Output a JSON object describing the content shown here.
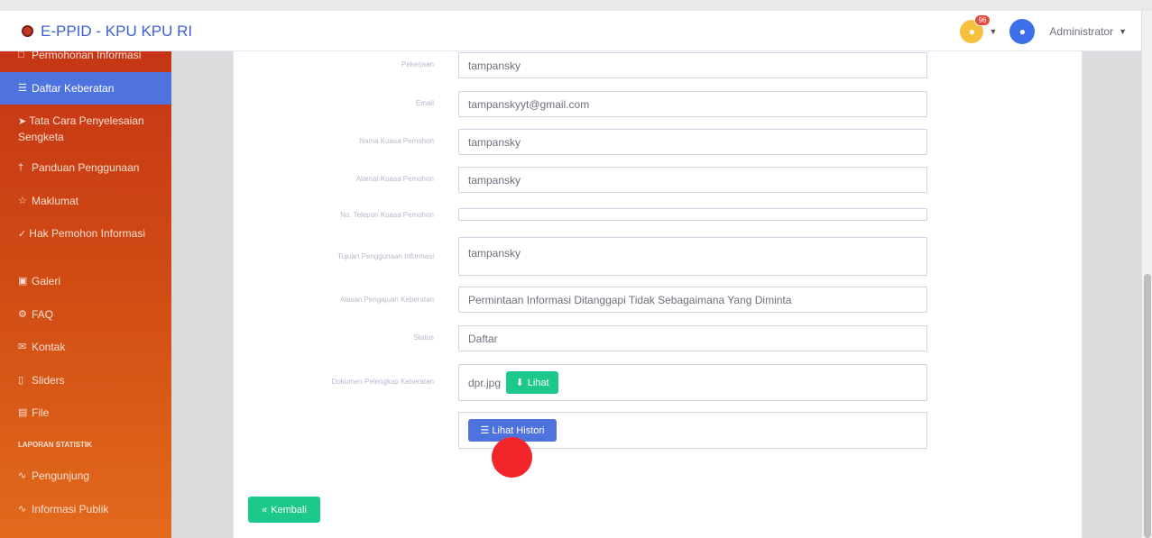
{
  "app": {
    "title": "E-PPID - KPU KPU RI"
  },
  "header": {
    "notification_count": "96",
    "user": "Administrator"
  },
  "sidebar": {
    "items": [
      {
        "icon": "document-icon",
        "label": "Permohonan Informasi"
      },
      {
        "icon": "database-icon",
        "label": "Daftar Keberatan",
        "active": true
      },
      {
        "icon": "rocket-icon",
        "label": "Tata Cara Penyelesaian Sengketa"
      },
      {
        "icon": "tools-icon",
        "label": "Panduan Penggunaan"
      },
      {
        "icon": "star-icon",
        "label": "Maklumat"
      },
      {
        "icon": "check-circle-icon",
        "label": "Hak Pemohon Informasi"
      },
      {
        "icon": "image-icon",
        "label": "Galeri"
      },
      {
        "icon": "faq-icon",
        "label": "FAQ"
      },
      {
        "icon": "mail-icon",
        "label": "Kontak"
      },
      {
        "icon": "slides-icon",
        "label": "Sliders"
      },
      {
        "icon": "file-icon",
        "label": "File"
      },
      {
        "icon": "chart-line-icon",
        "label": "Pengunjung"
      },
      {
        "icon": "chart-line-icon",
        "label": "Informasi Publik"
      }
    ],
    "section_heading": "LAPORAN STATISTIK"
  },
  "form": {
    "rows": [
      {
        "label": "Pekerjaan",
        "value": "tampansky"
      },
      {
        "label": "Email",
        "value": "tampanskyyt@gmail.com"
      },
      {
        "label": "Nama Kuasa Pemohon",
        "value": "tampansky"
      },
      {
        "label": "Alamat Kuasa Pemohon",
        "value": "tampansky"
      },
      {
        "label": "No. Telepon Kuasa Pemohon",
        "value": ""
      },
      {
        "label": "Tujuan Penggunaan Informasi",
        "value": "tampansky"
      },
      {
        "label": "Alasan Pengajuan Keberatan",
        "value": "Permintaan Informasi Ditanggapi Tidak Sebagaimana Yang Diminta"
      },
      {
        "label": "Status",
        "value": "Daftar"
      },
      {
        "label": "Dokumen Pelengkap Keberatan",
        "value": "dpr.jpg"
      }
    ],
    "lihat_label": "Lihat",
    "histori_label": "Lihat Histori",
    "back_label": "Kembali"
  }
}
